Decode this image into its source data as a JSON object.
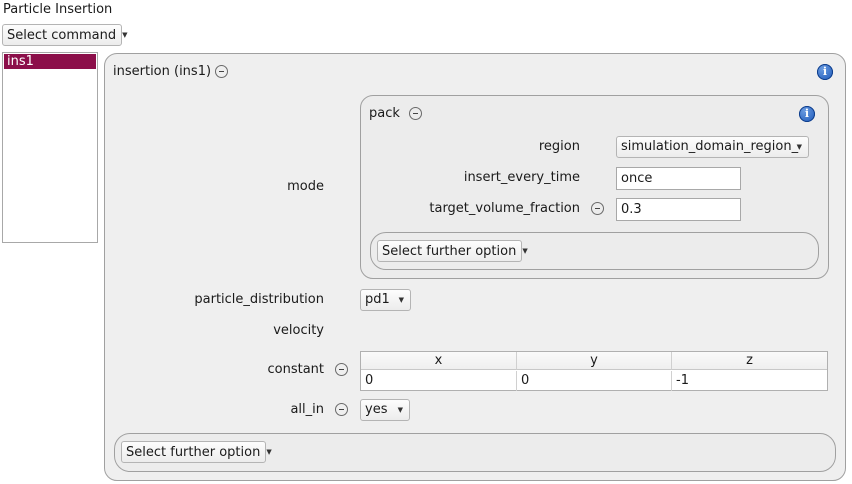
{
  "window": {
    "title": "Particle Insertion"
  },
  "toolbar": {
    "select_command_label": "Select command"
  },
  "list": {
    "items": [
      "ins1"
    ],
    "selected": "ins1"
  },
  "insertion": {
    "title": "insertion (ins1)",
    "mode_label": "mode",
    "pack": {
      "title": "pack",
      "region_label": "region",
      "region_value": "simulation_domain_region_",
      "insert_every_time_label": "insert_every_time",
      "insert_every_time_value": "once",
      "target_volume_fraction_label": "target_volume_fraction",
      "target_volume_fraction_value": "0.3",
      "further_option_label": "Select further option"
    },
    "particle_distribution_label": "particle_distribution",
    "particle_distribution_value": "pd1",
    "velocity_label": "velocity",
    "constant_label": "constant",
    "constant_table": {
      "headers": [
        "x",
        "y",
        "z"
      ],
      "values": [
        "0",
        "0",
        "-1"
      ]
    },
    "all_in_label": "all_in",
    "all_in_value": "yes",
    "further_option_label": "Select further option"
  },
  "colors": {
    "selection": "#8c0f4a",
    "panel_bg": "#efefef",
    "info_icon": "#1b57b8"
  },
  "icons": {
    "info": "info-icon",
    "remove": "minus-circle-icon",
    "dropdown": "caret-down-icon"
  }
}
